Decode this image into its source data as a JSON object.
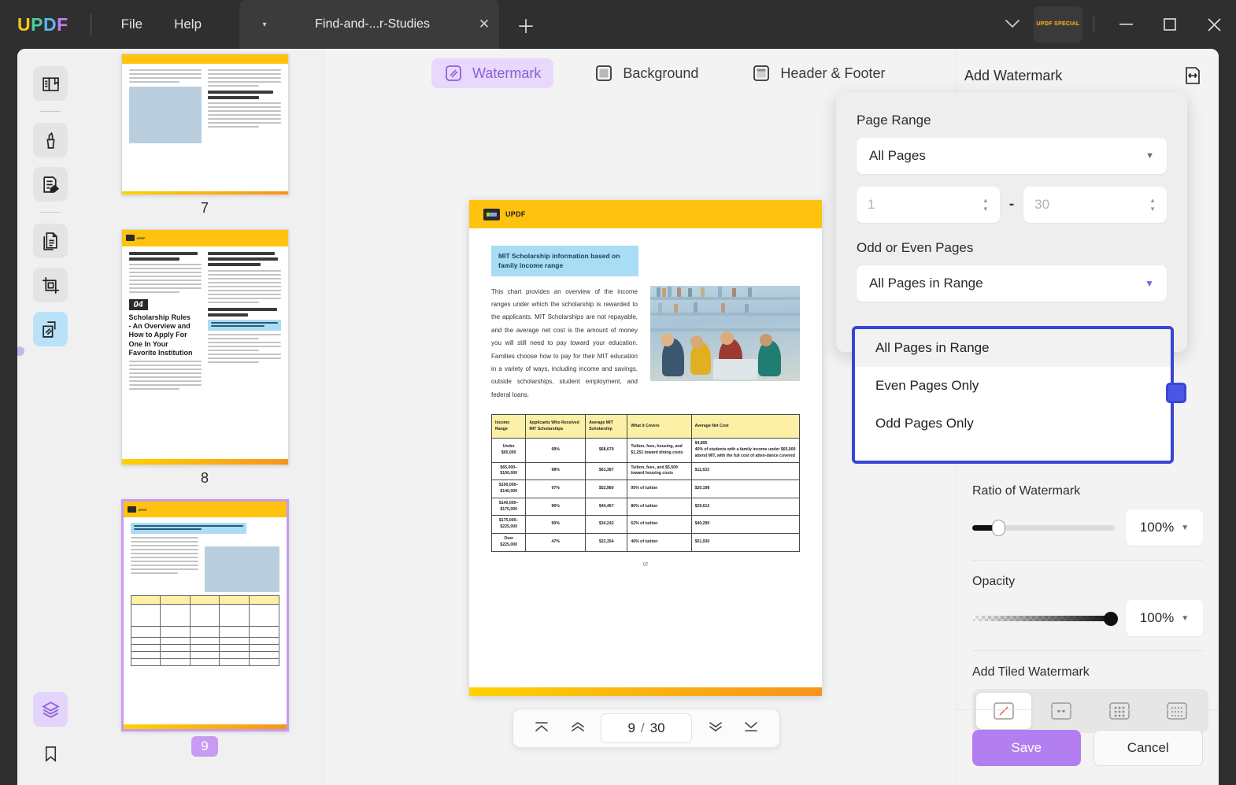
{
  "titlebar": {
    "logo": [
      "U",
      "P",
      "D",
      "F"
    ],
    "menus": [
      "File",
      "Help"
    ],
    "tab_title": "Find-and-...r-Studies",
    "tab_close_icon": "close-icon",
    "new_tab_icon": "plus-icon",
    "chevron_icon": "chevron-down-icon",
    "promo_badge": "UPDF\nSPECIAL",
    "minimize_icon": "minimize-icon",
    "maximize_icon": "maximize-icon",
    "close_icon": "close-icon"
  },
  "rail": {
    "items": [
      {
        "name": "reader-icon",
        "label": "Reader"
      },
      {
        "name": "annotate-icon",
        "label": "Comment"
      },
      {
        "name": "edit-pdf-icon",
        "label": "Edit PDF"
      },
      {
        "name": "organize-pages-icon",
        "label": "Organize Pages"
      },
      {
        "name": "crop-icon",
        "label": "Crop"
      },
      {
        "name": "watermark-icon",
        "label": "Watermark"
      }
    ],
    "bottom": [
      {
        "name": "batch-layers-icon",
        "label": "Batch"
      },
      {
        "name": "bookmark-icon",
        "label": "Bookmark"
      }
    ]
  },
  "thumbnails": {
    "pages": [
      {
        "number": "7",
        "selected": false
      },
      {
        "number": "8",
        "selected": false
      },
      {
        "number": "9",
        "selected": true
      }
    ]
  },
  "mode_tabs": [
    {
      "label": "Watermark",
      "icon": "watermark-icon",
      "active": true
    },
    {
      "label": "Background",
      "icon": "background-icon",
      "active": false
    },
    {
      "label": "Header & Footer",
      "icon": "header-footer-icon",
      "active": false
    }
  ],
  "document": {
    "brand": "UPDF",
    "callout": "MIT Scholarship information based on family income range",
    "paragraph": "This chart provides an overview of the income ranges under which the scholarship is rewarded to the applicants. MIT Scholarships are not repayable, and the average net cost is the amount of money you will still need to pay toward your education. Families choose how to pay for their MIT education in a variety of ways, including income and savings, outside scholarships, student employment, and federal loans.",
    "photo_alt": "students-studying-in-library-photo",
    "page_number": "07",
    "table": {
      "headers": [
        "Income Range",
        "Applicants Who Received MIT Scholarships",
        "Average MIT Scholarship",
        "What it Covers",
        "Average Net Cost"
      ],
      "rows": [
        [
          "Under $65,000",
          "99%",
          "$68,679",
          "Tuition, fees, housing, and $1,251 toward dining costs",
          "$4,895\n40% of students with a family income under $65,000 attend MIT, with the full cost of atten-dance covered"
        ],
        [
          "$65,000–$100,000",
          "98%",
          "$61,387",
          "Tuition, fees, and $5,509 toward housing costs",
          "$11,633"
        ],
        [
          "$100,000–$140,000",
          "97%",
          "$52,980",
          "95% of tuition",
          "$20,198"
        ],
        [
          "$140,000–$175,000",
          "96%",
          "$44,467",
          "80% of tuition",
          "$29,613"
        ],
        [
          "$175,000–$225,000",
          "90%",
          "$34,242",
          "62% of tuition",
          "$40,290"
        ],
        [
          "Over $225,000",
          "47%",
          "$22,354",
          "40% of tuition",
          "$51,930"
        ]
      ]
    }
  },
  "pager": {
    "first_icon": "first-page-icon",
    "prev_icon": "prev-page-icon",
    "current": "9",
    "separator": "/",
    "total": "30",
    "next_icon": "next-page-icon",
    "last_icon": "last-page-icon"
  },
  "panel": {
    "title": "Add Watermark",
    "resize_icon": "fit-width-icon",
    "ratio": {
      "label": "Ratio of Watermark",
      "value": "100%",
      "position_percent": 15
    },
    "opacity": {
      "label": "Opacity",
      "value": "100%",
      "position_percent": 100
    },
    "tiled": {
      "label": "Add Tiled Watermark",
      "options": [
        {
          "icon": "tile-none-icon",
          "selected": true
        },
        {
          "icon": "tile-2x1-icon",
          "selected": false
        },
        {
          "icon": "tile-3x3-icon",
          "selected": false
        },
        {
          "icon": "tile-4x3-icon",
          "selected": false
        }
      ]
    },
    "save_label": "Save",
    "cancel_label": "Cancel"
  },
  "popover": {
    "page_range_label": "Page Range",
    "page_range_value": "All Pages",
    "range_from_placeholder": "1",
    "range_to_placeholder": "30",
    "range_dash": "-",
    "odd_even_label": "Odd or Even Pages",
    "odd_even_value": "All Pages in Range",
    "dropdown_options": [
      {
        "label": "All Pages in Range",
        "highlighted": true
      },
      {
        "label": "Even Pages Only",
        "highlighted": false
      },
      {
        "label": "Odd Pages Only",
        "highlighted": false
      }
    ]
  },
  "colors": {
    "accent_purple": "#b37ef0",
    "highlight_blue": "#3a45d6",
    "brand_yellow": "#ffc20e",
    "tab_active_bg": "#e8d8fc"
  }
}
